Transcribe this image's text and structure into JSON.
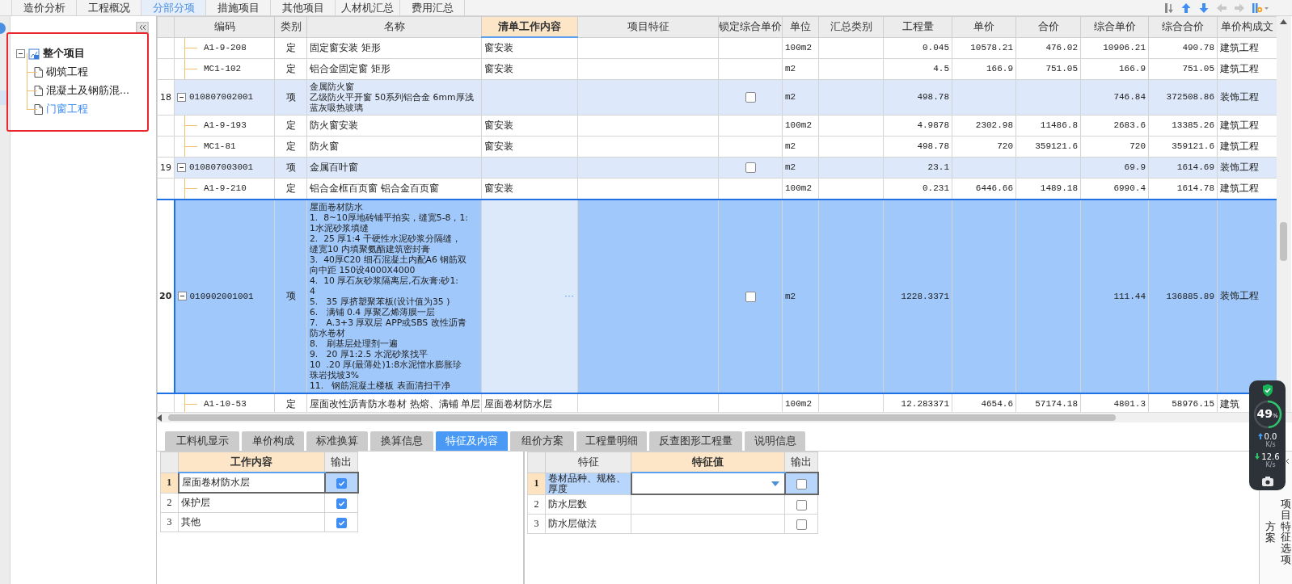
{
  "top_tabs": [
    {
      "label": "造价分析",
      "selected": false
    },
    {
      "label": "工程概况",
      "selected": false
    },
    {
      "label": "分部分项",
      "selected": true
    },
    {
      "label": "措施项目",
      "selected": false
    },
    {
      "label": "其他项目",
      "selected": false
    },
    {
      "label": "人材机汇总",
      "selected": false
    },
    {
      "label": "费用汇总",
      "selected": false
    }
  ],
  "toolbar": [
    {
      "kind": "sort",
      "disabled": false
    },
    {
      "kind": "up",
      "disabled": false
    },
    {
      "kind": "down",
      "disabled": false
    },
    {
      "kind": "left",
      "disabled": true
    },
    {
      "kind": "right",
      "disabled": true
    },
    {
      "kind": "settings",
      "disabled": false
    }
  ],
  "tree": {
    "label": "整个项目",
    "expanded": true,
    "children": [
      {
        "label": "砌筑工程",
        "selected": false
      },
      {
        "label": "混凝土及钢筋混...",
        "selected": false
      },
      {
        "label": "门窗工程",
        "selected": true
      }
    ]
  },
  "grid": {
    "columns": [
      {
        "label": "编码",
        "highlighted": false
      },
      {
        "label": "类别",
        "highlighted": false
      },
      {
        "label": "名称",
        "highlighted": false
      },
      {
        "label": "清单工作内容",
        "highlighted": true
      },
      {
        "label": "项目特征",
        "highlighted": false
      },
      {
        "label": "锁定综合单价",
        "highlighted": false
      },
      {
        "label": "单位",
        "highlighted": false
      },
      {
        "label": "汇总类别",
        "highlighted": false
      },
      {
        "label": "工程量",
        "highlighted": false
      },
      {
        "label": "单价",
        "highlighted": false
      },
      {
        "label": "合价",
        "highlighted": false
      },
      {
        "label": "综合单价",
        "highlighted": false
      },
      {
        "label": "综合合价",
        "highlighted": false
      },
      {
        "label": "单价构成文",
        "highlighted": false
      }
    ],
    "rows": [
      {
        "kind": "quota",
        "code": "A1-9-208",
        "type": "定",
        "name": "固定窗安装 矩形",
        "work_content": "窗安装",
        "unit": "100m2",
        "quantity": "0.045",
        "unit_price": "10578.21",
        "total": "476.02",
        "comp_unit_price": "10906.21",
        "comp_total": "490.78",
        "composition": "建筑工程",
        "selected": false
      },
      {
        "kind": "quota",
        "code": "MC1-102",
        "type": "定",
        "name": "铝合金固定窗 矩形",
        "work_content": "窗安装",
        "unit": "m2",
        "quantity": "4.5",
        "unit_price": "166.9",
        "total": "751.05",
        "comp_unit_price": "166.9",
        "comp_total": "751.05",
        "composition": "建筑工程",
        "selected": false
      },
      {
        "kind": "item",
        "number": "18",
        "expanded": true,
        "code": "010807002001",
        "type": "项",
        "name_lines": [
          "金属防火窗",
          "乙级防火平开窗 50系列铝合金 6mm厚浅",
          "蓝灰吸热玻璃"
        ],
        "locked": false,
        "unit": "m2",
        "quantity": "498.78",
        "comp_unit_price": "746.84",
        "comp_total": "372508.86",
        "composition": "装饰工程",
        "selected": false
      },
      {
        "kind": "quota",
        "code": "A1-9-193",
        "type": "定",
        "name": "防火窗安装",
        "work_content": "窗安装",
        "unit": "100m2",
        "quantity": "4.9878",
        "unit_price": "2302.98",
        "total": "11486.8",
        "comp_unit_price": "2683.6",
        "comp_total": "13385.26",
        "composition": "建筑工程",
        "selected": false
      },
      {
        "kind": "quota",
        "code": "MC1-81",
        "type": "定",
        "name": "防火窗",
        "work_content": "窗安装",
        "unit": "m2",
        "quantity": "498.78",
        "unit_price": "720",
        "total": "359121.6",
        "comp_unit_price": "720",
        "comp_total": "359121.6",
        "composition": "建筑工程",
        "selected": false
      },
      {
        "kind": "item",
        "number": "19",
        "expanded": true,
        "code": "010807003001",
        "type": "项",
        "name": "金属百叶窗",
        "locked": false,
        "unit": "m2",
        "quantity": "23.1",
        "comp_unit_price": "69.9",
        "comp_total": "1614.69",
        "composition": "装饰工程",
        "selected": false
      },
      {
        "kind": "quota",
        "code": "A1-9-210",
        "type": "定",
        "name": "铝合金框百页窗 铝合金百页窗",
        "work_content": "窗安装",
        "unit": "100m2",
        "quantity": "0.231",
        "unit_price": "6446.66",
        "total": "1489.18",
        "comp_unit_price": "6990.4",
        "comp_total": "1614.78",
        "composition": "建筑工程",
        "selected": false
      },
      {
        "kind": "item",
        "number": "20",
        "expanded": true,
        "code": "010902001001",
        "type": "项",
        "name_lines": [
          "屋面卷材防水",
          "1.  8~10厚地砖铺平拍实，缝宽5-8，1:",
          "1水泥砂浆填缝",
          "2.  25 厚1:4 干硬性水泥砂浆分隔缝，",
          "缝宽10 内填聚氨酯建筑密封膏",
          "3.  40厚C20 细石混凝土内配A6 钢筋双",
          "向中距 150设4000X4000",
          "4.  10 厚石灰砂浆隔离层,石灰膏:砂1:",
          "4",
          "5.   35 厚挤塑聚苯板(设计值为35 )",
          "6.   满铺 0.4 厚聚乙烯薄膜一层",
          "7.   A.3+3 厚双层 APP或SBS 改性沥青",
          "防水卷材",
          "8.   刷基层处理剂一遍",
          "9.   20 厚1:2.5 水泥砂浆找平",
          "10  .20 厚(最薄处)1:8水泥憎水膨胀珍",
          "珠岩找坡3%",
          "11.   钢筋混凝土楼板 表面清扫干净"
        ],
        "more_button": "···",
        "locked": false,
        "unit": "m2",
        "quantity": "1228.3371",
        "comp_unit_price": "111.44",
        "comp_total": "136885.89",
        "composition": "装饰工程",
        "selected": true
      },
      {
        "kind": "quota",
        "code": "A1-10-53",
        "type": "定",
        "name": "屋面改性沥青防水卷材 热熔、满铺 单层",
        "work_content": "屋面卷材防水层",
        "unit": "100m2",
        "quantity": "12.283371",
        "unit_price": "4654.6",
        "total": "57174.18",
        "comp_unit_price": "4801.3",
        "comp_total": "58976.15",
        "composition": "建筑",
        "selected": false
      }
    ]
  },
  "bottom_tabs": [
    {
      "label": "工料机显示",
      "selected": false
    },
    {
      "label": "单价构成",
      "selected": false
    },
    {
      "label": "标准换算",
      "selected": false
    },
    {
      "label": "换算信息",
      "selected": false
    },
    {
      "label": "特征及内容",
      "selected": true
    },
    {
      "label": "组价方案",
      "selected": false
    },
    {
      "label": "工程量明细",
      "selected": false
    },
    {
      "label": "反查图形工程量",
      "selected": false
    },
    {
      "label": "说明信息",
      "selected": false
    }
  ],
  "work_content": {
    "columns": [
      {
        "label": "工作内容",
        "highlighted": true
      },
      {
        "label": "输出",
        "highlighted": false
      }
    ],
    "rows": [
      {
        "number": "1",
        "content": "屋面卷材防水层",
        "output": true,
        "selected": true
      },
      {
        "number": "2",
        "content": "保护层",
        "output": true,
        "selected": false
      },
      {
        "number": "3",
        "content": "其他",
        "output": true,
        "selected": false
      }
    ]
  },
  "features": {
    "columns": [
      {
        "label": "特征",
        "highlighted": false
      },
      {
        "label": "特征值",
        "highlighted": true
      },
      {
        "label": "输出",
        "highlighted": false
      }
    ],
    "rows": [
      {
        "number": "1",
        "feature": "卷材品种、规格、厚度",
        "output": false,
        "selected": true
      },
      {
        "number": "2",
        "feature": "防水层数",
        "output": false,
        "selected": false
      },
      {
        "number": "3",
        "feature": "防水层做法",
        "output": false,
        "selected": false
      }
    ]
  },
  "side_panel": {
    "tabs": [
      {
        "label": "方案"
      },
      {
        "label": "项目特征选项"
      }
    ]
  },
  "monitor": {
    "percent": "49",
    "percent_unit": "%",
    "level": 0.49,
    "upload": "0.0",
    "upload_unit": "K/s",
    "download": "12.6",
    "download_unit": "K/s"
  }
}
